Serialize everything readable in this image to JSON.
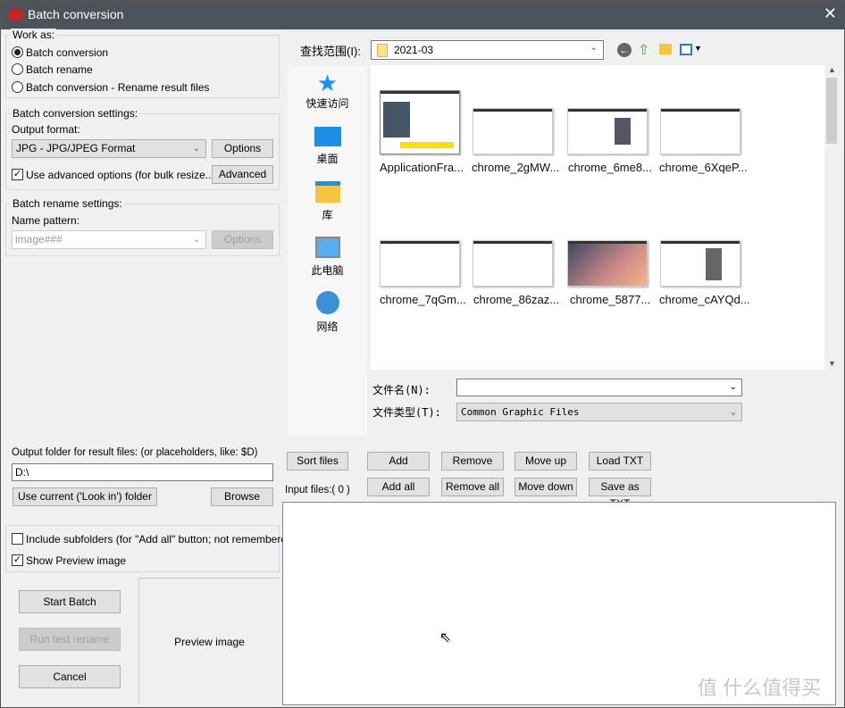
{
  "window": {
    "title": "Batch conversion",
    "close": "✕"
  },
  "work_as": {
    "legend": "Work as:",
    "options": [
      {
        "label": "Batch conversion",
        "selected": true
      },
      {
        "label": "Batch rename",
        "selected": false
      },
      {
        "label": "Batch conversion - Rename result files",
        "selected": false
      }
    ]
  },
  "conversion": {
    "legend": "Batch conversion settings:",
    "format_label": "Output format:",
    "format_value": "JPG - JPG/JPEG Format",
    "options_btn": "Options",
    "advanced_check": "Use advanced options (for bulk resize...)",
    "advanced_checked": true,
    "advanced_btn": "Advanced"
  },
  "rename": {
    "legend": "Batch rename settings:",
    "pattern_label": "Name pattern:",
    "pattern_value": "image###",
    "options_btn": "Options"
  },
  "output": {
    "label": "Output folder for result files: (or placeholders, like: $D)",
    "value": "D:\\",
    "use_current_btn": "Use current ('Look in') folder",
    "browse_btn": "Browse"
  },
  "flags": {
    "include_subfolders": "Include subfolders (for \"Add all\" button; not remembered)",
    "include_checked": false,
    "show_preview": "Show Preview image",
    "preview_checked": true
  },
  "actions": {
    "start": "Start Batch",
    "run_test": "Run test rename",
    "cancel": "Cancel"
  },
  "preview": {
    "label": "Preview image"
  },
  "browser": {
    "look_in_label": "查找范围(I):",
    "look_in_value": "2021-03",
    "places": [
      {
        "label": "快速访问",
        "icon": "star-icon"
      },
      {
        "label": "桌面",
        "icon": "desktop-icon"
      },
      {
        "label": "库",
        "icon": "library-icon"
      },
      {
        "label": "此电脑",
        "icon": "computer-icon"
      },
      {
        "label": "网络",
        "icon": "network-icon"
      }
    ],
    "files": [
      "ApplicationFra...",
      "chrome_2gMW...",
      "chrome_6me8...",
      "chrome_6XqeP...",
      "chrome_7qGm...",
      "chrome_86zaz...",
      "chrome_5877...",
      "chrome_cAYQd..."
    ],
    "filename_label": "文件名(N):",
    "filename_value": "",
    "filetype_label": "文件类型(T):",
    "filetype_value": "Common Graphic Files"
  },
  "list": {
    "sort": "Sort files",
    "add": "Add",
    "remove": "Remove",
    "move_up": "Move up",
    "load_txt": "Load TXT",
    "add_all": "Add all",
    "remove_all": "Remove all",
    "move_down": "Move down",
    "save_txt": "Save as TXT",
    "input_files": "Input files:( 0 )"
  },
  "watermark": "值 什么值得买"
}
